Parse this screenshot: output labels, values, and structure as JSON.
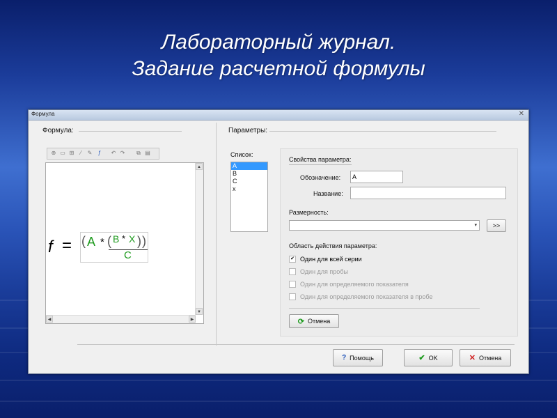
{
  "slide": {
    "title_line1": "Лабораторный журнал.",
    "title_line2": "Задание расчетной формулы"
  },
  "dialog": {
    "window_title": "Формула",
    "close_glyph": "✕"
  },
  "formula_panel": {
    "label": "Формула:",
    "toolbar_icons": [
      "insert-icon",
      "fraction-icon",
      "sqrt-icon",
      "italic-icon",
      "brush-icon",
      "function-icon",
      "undo-icon",
      "redo-icon",
      "copy-icon",
      "paste-icon"
    ],
    "formula": {
      "symbol": "f",
      "equals": "=",
      "open_paren": "(",
      "var_a": "A",
      "op_mul1": "*",
      "inner_open": "(",
      "var_b": "B",
      "op_mul2": "*",
      "var_x": "X",
      "inner_close": ")",
      "close_paren": ")",
      "denominator": "C"
    }
  },
  "params_panel": {
    "label": "Параметры:",
    "list_label": "Список:",
    "list_items": [
      "A",
      "B",
      "C",
      "x"
    ],
    "selected_index": 0,
    "properties_label": "Свойства параметра:",
    "designation_label": "Обозначение:",
    "designation_value": "A",
    "name_label": "Название:",
    "name_value": "",
    "dimension_label": "Размерность:",
    "dimension_value": "",
    "dimension_button": ">>",
    "scope_label": "Область действия параметра:",
    "scope_options": [
      {
        "label": "Один для всей серии",
        "checked": true,
        "enabled": true
      },
      {
        "label": "Один для пробы",
        "checked": false,
        "enabled": false
      },
      {
        "label": "Один для определяемого показателя",
        "checked": false,
        "enabled": false
      },
      {
        "label": "Один для определяемого показателя в пробе",
        "checked": false,
        "enabled": false
      }
    ],
    "cancel_label": "Отмена"
  },
  "footer": {
    "help_label": "Помощь",
    "ok_label": "OK",
    "cancel_label": "Отмена"
  },
  "colors": {
    "formula_var": "#1d9a1d",
    "selection": "#3399ff"
  }
}
